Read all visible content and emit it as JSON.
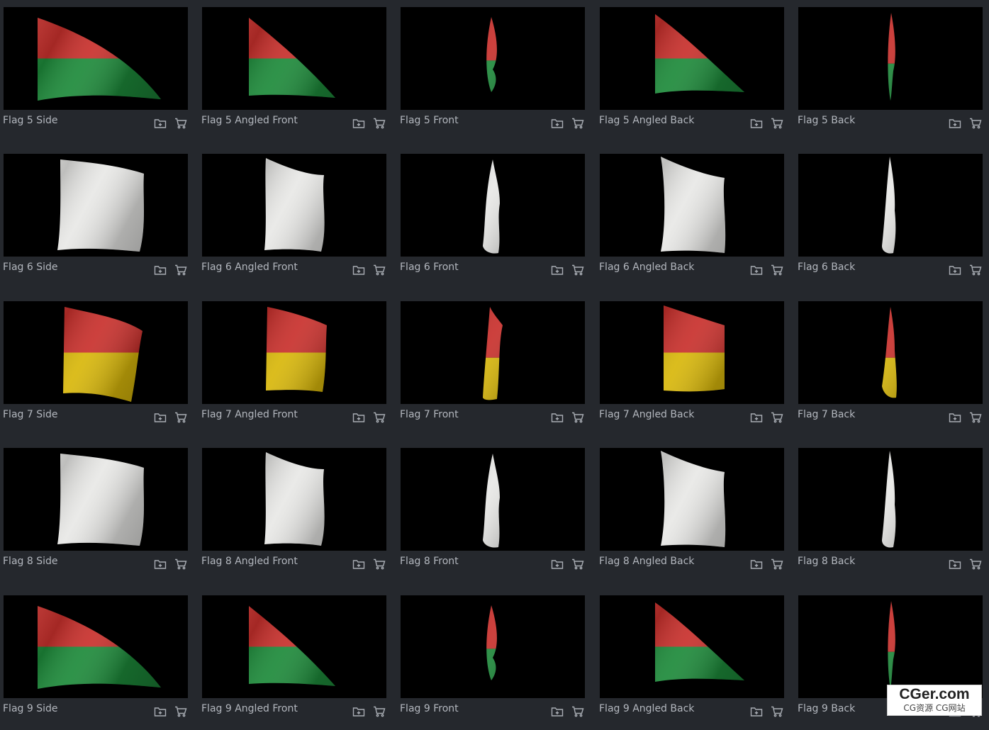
{
  "colors": {
    "background": "#25282d",
    "thumb_bg": "#000000",
    "label": "#b3b7be",
    "icon": "#a9adb4",
    "red": "#c8302c",
    "green": "#1d8a3a",
    "yellow": "#d8b70a",
    "white": "#e8e8e6"
  },
  "icons": {
    "add": "folder-plus-icon",
    "cart": "cart-icon"
  },
  "rows": [
    {
      "flag": "flag-5",
      "scheme": "red-green",
      "items": [
        {
          "label": "Flag 5 Side",
          "view": "side"
        },
        {
          "label": "Flag 5 Angled Front",
          "view": "angled-front"
        },
        {
          "label": "Flag 5 Front",
          "view": "front"
        },
        {
          "label": "Flag 5 Angled Back",
          "view": "angled-back"
        },
        {
          "label": "Flag 5 Back",
          "view": "back"
        }
      ]
    },
    {
      "flag": "flag-6",
      "scheme": "white",
      "items": [
        {
          "label": "Flag 6 Side",
          "view": "side"
        },
        {
          "label": "Flag 6 Angled Front",
          "view": "angled-front"
        },
        {
          "label": "Flag 6 Front",
          "view": "front"
        },
        {
          "label": "Flag 6 Angled Back",
          "view": "angled-back"
        },
        {
          "label": "Flag 6 Back",
          "view": "back"
        }
      ]
    },
    {
      "flag": "flag-7",
      "scheme": "red-yellow",
      "items": [
        {
          "label": "Flag 7 Side",
          "view": "side"
        },
        {
          "label": "Flag 7 Angled Front",
          "view": "angled-front"
        },
        {
          "label": "Flag 7 Front",
          "view": "front"
        },
        {
          "label": "Flag 7 Angled Back",
          "view": "angled-back"
        },
        {
          "label": "Flag 7 Back",
          "view": "back"
        }
      ]
    },
    {
      "flag": "flag-8",
      "scheme": "white",
      "items": [
        {
          "label": "Flag 8 Side",
          "view": "side"
        },
        {
          "label": "Flag 8 Angled Front",
          "view": "angled-front"
        },
        {
          "label": "Flag 8 Front",
          "view": "front"
        },
        {
          "label": "Flag 8 Angled Back",
          "view": "angled-back"
        },
        {
          "label": "Flag 8 Back",
          "view": "back"
        }
      ]
    },
    {
      "flag": "flag-9",
      "scheme": "red-green",
      "items": [
        {
          "label": "Flag 9 Side",
          "view": "side"
        },
        {
          "label": "Flag 9 Angled Front",
          "view": "angled-front"
        },
        {
          "label": "Flag 9 Front",
          "view": "front"
        },
        {
          "label": "Flag 9 Angled Back",
          "view": "angled-back"
        },
        {
          "label": "Flag 9 Back",
          "view": "back"
        }
      ]
    }
  ],
  "watermark": {
    "main": "CGer.com",
    "sub": "CG资源 CG网站"
  }
}
